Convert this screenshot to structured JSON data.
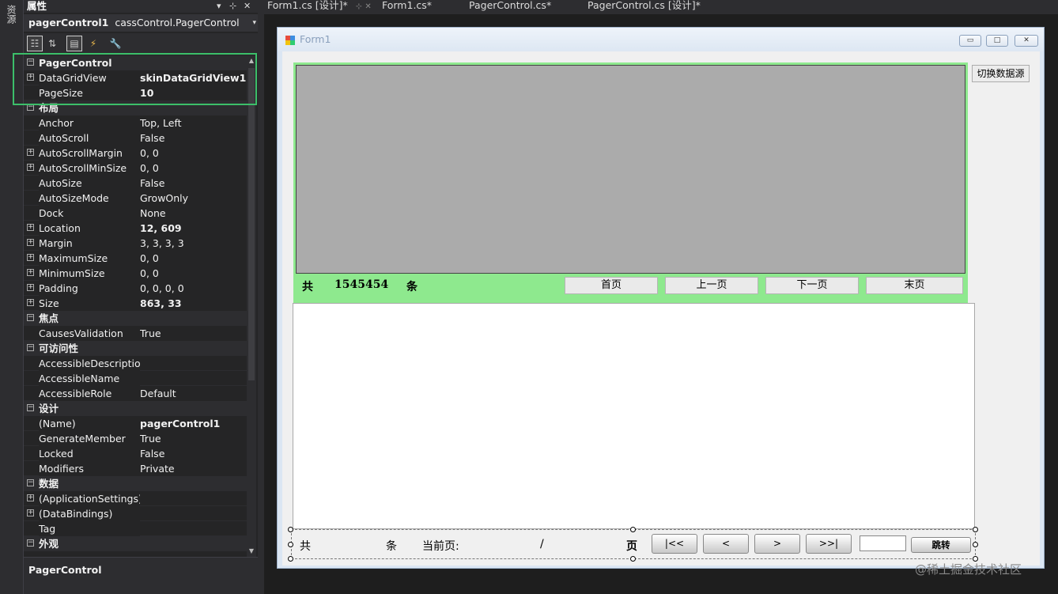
{
  "left_tab": {
    "label": "资源"
  },
  "properties": {
    "title": "属性",
    "object_name": "pagerControl1",
    "object_type": "cassControl.PagerControl",
    "description_title": "PagerControl",
    "rows": [
      {
        "kind": "cat",
        "name": "PagerControl",
        "value": ""
      },
      {
        "kind": "prop",
        "exp": "+",
        "name": "DataGridView",
        "value": "skinDataGridView1",
        "bold": true
      },
      {
        "kind": "prop",
        "exp": "",
        "name": "PageSize",
        "value": "10",
        "bold": true
      },
      {
        "kind": "cat",
        "name": "布局",
        "value": ""
      },
      {
        "kind": "prop",
        "exp": "",
        "name": "Anchor",
        "value": "Top, Left"
      },
      {
        "kind": "prop",
        "exp": "",
        "name": "AutoScroll",
        "value": "False"
      },
      {
        "kind": "prop",
        "exp": "+",
        "name": "AutoScrollMargin",
        "value": "0, 0"
      },
      {
        "kind": "prop",
        "exp": "+",
        "name": "AutoScrollMinSize",
        "value": "0, 0"
      },
      {
        "kind": "prop",
        "exp": "",
        "name": "AutoSize",
        "value": "False"
      },
      {
        "kind": "prop",
        "exp": "",
        "name": "AutoSizeMode",
        "value": "GrowOnly"
      },
      {
        "kind": "prop",
        "exp": "",
        "name": "Dock",
        "value": "None"
      },
      {
        "kind": "prop",
        "exp": "+",
        "name": "Location",
        "value": "12, 609",
        "bold": true
      },
      {
        "kind": "prop",
        "exp": "+",
        "name": "Margin",
        "value": "3, 3, 3, 3"
      },
      {
        "kind": "prop",
        "exp": "+",
        "name": "MaximumSize",
        "value": "0, 0"
      },
      {
        "kind": "prop",
        "exp": "+",
        "name": "MinimumSize",
        "value": "0, 0"
      },
      {
        "kind": "prop",
        "exp": "+",
        "name": "Padding",
        "value": "0, 0, 0, 0"
      },
      {
        "kind": "prop",
        "exp": "+",
        "name": "Size",
        "value": "863, 33",
        "bold": true
      },
      {
        "kind": "cat",
        "name": "焦点",
        "value": ""
      },
      {
        "kind": "prop",
        "exp": "",
        "name": "CausesValidation",
        "value": "True"
      },
      {
        "kind": "cat",
        "name": "可访问性",
        "value": ""
      },
      {
        "kind": "prop",
        "exp": "",
        "name": "AccessibleDescriptior",
        "value": ""
      },
      {
        "kind": "prop",
        "exp": "",
        "name": "AccessibleName",
        "value": ""
      },
      {
        "kind": "prop",
        "exp": "",
        "name": "AccessibleRole",
        "value": "Default"
      },
      {
        "kind": "cat",
        "name": "设计",
        "value": ""
      },
      {
        "kind": "prop",
        "exp": "",
        "name": "(Name)",
        "value": "pagerControl1",
        "bold": true
      },
      {
        "kind": "prop",
        "exp": "",
        "name": "GenerateMember",
        "value": "True"
      },
      {
        "kind": "prop",
        "exp": "",
        "name": "Locked",
        "value": "False"
      },
      {
        "kind": "prop",
        "exp": "",
        "name": "Modifiers",
        "value": "Private"
      },
      {
        "kind": "cat",
        "name": "数据",
        "value": ""
      },
      {
        "kind": "prop",
        "exp": "+",
        "name": "(ApplicationSettings)",
        "value": ""
      },
      {
        "kind": "prop",
        "exp": "+",
        "name": "(DataBindings)",
        "value": ""
      },
      {
        "kind": "prop",
        "exp": "",
        "name": "Tag",
        "value": ""
      },
      {
        "kind": "cat",
        "name": "外观",
        "value": ""
      }
    ]
  },
  "tabs": [
    {
      "label": "Form1.cs [设计]*",
      "icons": "⊹ ✕"
    },
    {
      "label": "Form1.cs*",
      "icons": ""
    },
    {
      "label": "PagerControl.cs*",
      "icons": ""
    },
    {
      "label": "PagerControl.cs [设计]*",
      "icons": ""
    }
  ],
  "form": {
    "caption": "Form1",
    "switch_button": "切换数据源",
    "pager_top": {
      "total_prefix": "共",
      "total_count": "1545454",
      "total_suffix": "条",
      "buttons": [
        "首页",
        "上一页",
        "下一页",
        "末页"
      ]
    },
    "pager_bottom": {
      "total_prefix": "共",
      "total_suffix": "条",
      "current_page_label": "当前页:",
      "slash": "/",
      "page_suffix": "页",
      "nav_buttons": [
        "|<<",
        "<",
        ">",
        ">>|"
      ],
      "jump_button": "跳转"
    }
  },
  "watermark": "@稀土掘金技术社区"
}
